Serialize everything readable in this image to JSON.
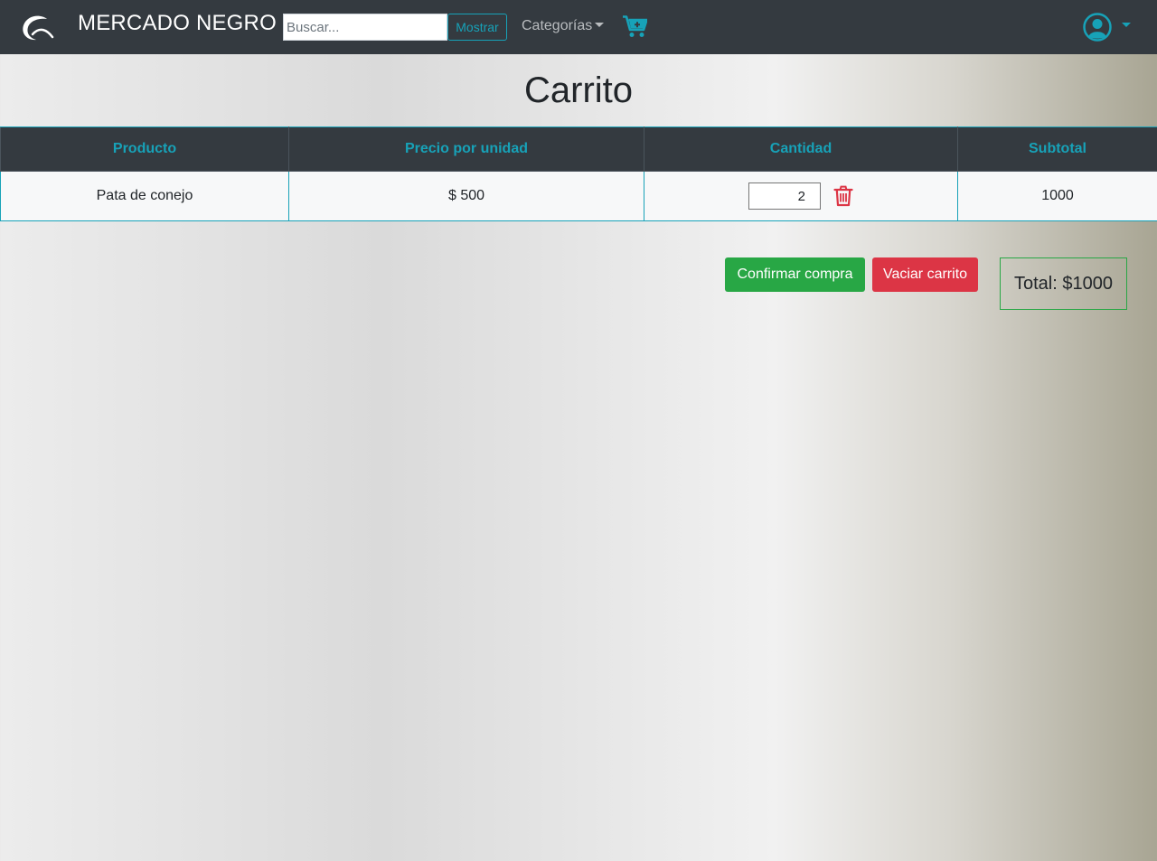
{
  "navbar": {
    "brand": "MERCADO NEGRO",
    "search_placeholder": "Buscar...",
    "search_button": "Mostrar",
    "categories_label": "Categorías",
    "logo_icon": "sickle-logo-icon",
    "cart_icon": "cart-plus-icon",
    "user_icon": "user-circle-icon"
  },
  "page": {
    "title": "Carrito"
  },
  "table": {
    "headers": [
      "Producto",
      "Precio por unidad",
      "Cantidad",
      "Subtotal"
    ],
    "rows": [
      {
        "product": "Pata de conejo",
        "price": "$ 500",
        "quantity": "2",
        "subtotal": "1000"
      }
    ]
  },
  "actions": {
    "confirm": "Confirmar compra",
    "empty": "Vaciar carrito",
    "total": "Total: $1000"
  },
  "colors": {
    "navbar": "#343a40",
    "accent": "#17a2b8",
    "success": "#28a745",
    "danger": "#dc3545"
  }
}
